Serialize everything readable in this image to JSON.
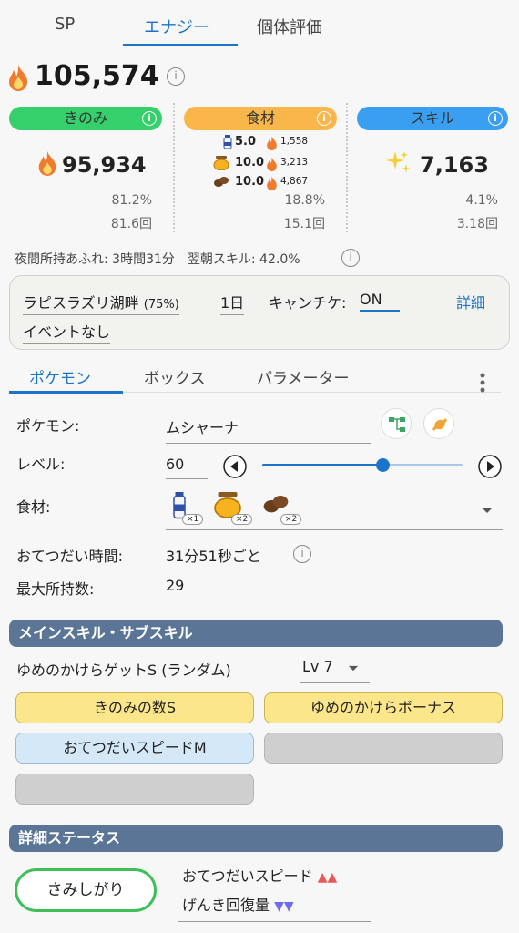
{
  "tabs": [
    "SP",
    "エナジー",
    "個体評価"
  ],
  "total_energy": "105,574",
  "categories": [
    {
      "label": "きのみ",
      "color": "#35d06b",
      "value": "95,934",
      "pct": "81.2%",
      "count": "81.6回"
    },
    {
      "label": "食材",
      "color": "#f9b64a",
      "pct": "18.8%",
      "count": "15.1回"
    },
    {
      "label": "スキル",
      "color": "#3a9ff0",
      "value": "7,163",
      "pct": "4.1%",
      "count": "3.18回"
    }
  ],
  "ingredients_stats": [
    {
      "icon": "milk-icon",
      "amount": "5.0",
      "energy": "1,558"
    },
    {
      "icon": "honey-icon",
      "amount": "10.0",
      "energy": "3,213"
    },
    {
      "icon": "coffee-icon",
      "amount": "10.0",
      "energy": "4,867"
    }
  ],
  "night_note": "夜間所持あふれ: 3時間31分　翌朝スキル: 42.0%",
  "config": {
    "area": "ラピスラズリ湖畔",
    "area_pct": "(75%)",
    "days": "1日",
    "camp_label": "キャンチケ:",
    "camp_value": "ON",
    "detail": "詳細",
    "event": "イベントなし"
  },
  "subtabs": [
    "ポケモン",
    "ボックス",
    "パラメーター"
  ],
  "pokemon": {
    "name_label": "ポケモン:",
    "name": "ムシャーナ",
    "level_label": "レベル:",
    "level": "60",
    "level_fraction": 0.6,
    "ingredient_label": "食材:",
    "ingredients": [
      {
        "icon": "milk-icon",
        "badge": "×1"
      },
      {
        "icon": "honey-icon",
        "badge": "×2"
      },
      {
        "icon": "coffee-icon",
        "badge": "×2"
      }
    ],
    "help_time_label": "おてつだい時間:",
    "help_time": "31分51秒ごと",
    "max_carry_label": "最大所持数:",
    "max_carry": "29"
  },
  "skills": {
    "section_title": "メインスキル・サブスキル",
    "main_skill": "ゆめのかけらゲットS (ランダム)",
    "main_level": "Lv 7",
    "sub": [
      "きのみの数S",
      "ゆめのかけらボーナス",
      "おてつだいスピードM",
      "",
      ""
    ]
  },
  "details": {
    "section_title": "詳細ステータス",
    "nature": "さみしがり",
    "up_label": "おてつだいスピード",
    "up_marks": "▲▲",
    "down_label": "げんき回復量",
    "down_marks": "▼▼"
  }
}
